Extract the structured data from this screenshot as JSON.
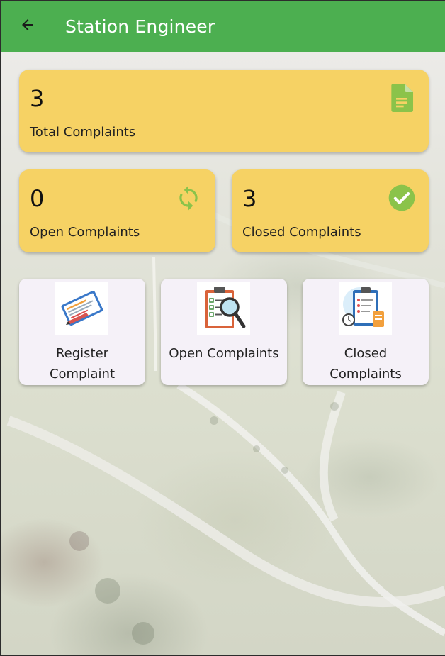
{
  "appbar": {
    "title": "Station Engineer",
    "back_icon": "arrow-left-icon",
    "color": "#4caf50"
  },
  "stats": {
    "total": {
      "count": "3",
      "label": "Total Complaints",
      "icon": "document-icon",
      "icon_color": "#8bc34a"
    },
    "open": {
      "count": "0",
      "label": "Open Complaints",
      "icon": "sync-icon",
      "icon_color": "#8bc34a"
    },
    "closed": {
      "count": "3",
      "label": "Closed Complaints",
      "icon": "check-circle-icon",
      "icon_color": "#8bc34a"
    },
    "card_color": "#f6d264"
  },
  "actions": [
    {
      "label": "Register Complaint",
      "icon": "register-form-icon"
    },
    {
      "label": "Open Complaints",
      "icon": "clipboard-search-icon"
    },
    {
      "label": "Closed Complaints",
      "icon": "clipboard-closed-icon"
    }
  ]
}
